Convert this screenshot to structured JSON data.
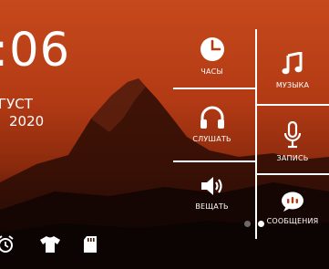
{
  "clock": {
    "time": ":06"
  },
  "date": {
    "month": "ГУСТ",
    "year": "2020"
  },
  "menu": {
    "clock_label": "ЧАСЫ",
    "music_label": "МУЗЫКА",
    "listen_label": "СЛУШАТЬ",
    "record_label": "ЗАПИСЬ",
    "broadcast_label": "ВЕЩАТЬ",
    "messages_label": "СООБЩЕНИЯ"
  },
  "pager": {
    "active_index": 2,
    "count": 2
  },
  "icons": {
    "clock": "clock-icon",
    "music": "music-note-icon",
    "listen": "headphones-icon",
    "record": "microphone-icon",
    "broadcast": "speaker-icon",
    "messages": "chat-bubble-icon",
    "alarm": "alarm-icon",
    "shirt": "shirt-icon",
    "sd": "sd-card-icon"
  },
  "colors": {
    "sky_top": "#c6491c",
    "sky_mid": "#8a2a0d",
    "ground": "#1a0904"
  }
}
